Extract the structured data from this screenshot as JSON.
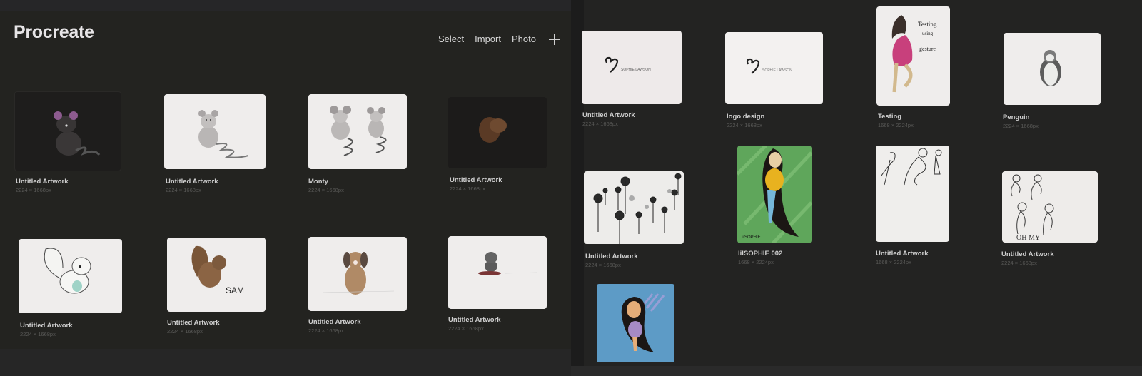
{
  "header": {
    "app_title": "Procreate",
    "toolbar": {
      "select_label": "Select",
      "import_label": "Import",
      "photo_label": "Photo",
      "new_icon": "plus-icon"
    }
  },
  "gallery_left": [
    {
      "title": "Untitled Artwork",
      "size": "2224 × 1668px",
      "subject": "mouse-on-black"
    },
    {
      "title": "Untitled Artwork",
      "size": "2224 × 1668px",
      "subject": "grey-mouse"
    },
    {
      "title": "Monty",
      "size": "2224 × 1668px",
      "subject": "two-mice"
    },
    {
      "title": "Untitled Artwork",
      "size": "2224 × 1668px",
      "subject": "squirrel-on-black"
    },
    {
      "title": "Untitled Artwork",
      "size": "2224 × 1668px",
      "subject": "white-squirrel"
    },
    {
      "title": "Untitled Artwork",
      "size": "2224 × 1668px",
      "subject": "brown-squirrel-sam"
    },
    {
      "title": "Untitled Artwork",
      "size": "2224 × 1668px",
      "subject": "brown-dog"
    },
    {
      "title": "Untitled Artwork",
      "size": "2224 × 1668px",
      "subject": "grey-cat"
    }
  ],
  "gallery_right": [
    {
      "title": "Untitled Artwork",
      "size": "2224 × 1668px",
      "subject": "heart-logo",
      "logo_text": "SOPHIE LAWSON"
    },
    {
      "title": "logo design",
      "size": "2224 × 1668px",
      "subject": "heart-logo",
      "logo_text": "SOPHIE LAWSON"
    },
    {
      "title": "Testing",
      "size": "1668 × 2224px",
      "subject": "girl-pink-dress",
      "note": "Testing using gesture"
    },
    {
      "title": "Penguin",
      "size": "2224 × 1668px",
      "subject": "penguin"
    },
    {
      "title": "Untitled Artwork",
      "size": "2224 × 1668px",
      "subject": "ink-drips"
    },
    {
      "title": "lilSOPHIE 002",
      "size": "1668 × 2224px",
      "subject": "girl-green-bg",
      "signature": "lilSOPHIE"
    },
    {
      "title": "Untitled Artwork",
      "size": "1668 × 2224px",
      "subject": "gesture-sketches"
    },
    {
      "title": "Untitled Artwork",
      "size": "2224 × 1668px",
      "subject": "gesture-sketches-2"
    },
    {
      "title": "",
      "size": "",
      "subject": "girl-blue-bg"
    }
  ]
}
